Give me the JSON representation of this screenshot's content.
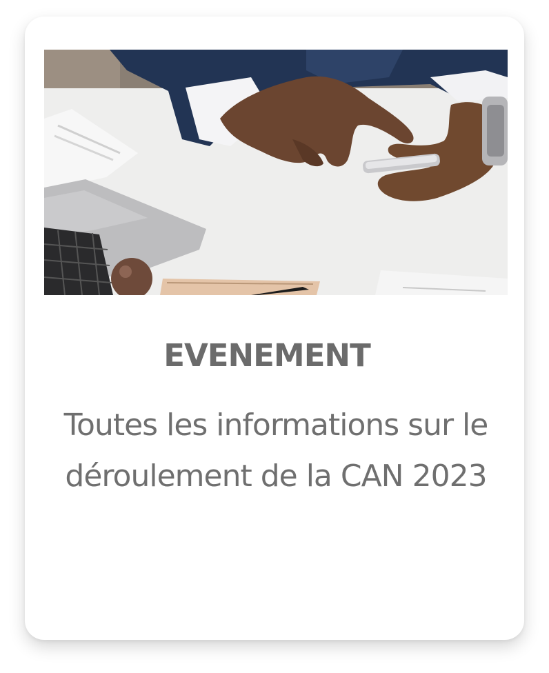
{
  "card": {
    "image_description": "hands holding smartphone on desk",
    "title": "EVENEMENT",
    "description": "Toutes les informations sur le déroulement de la CAN 2023"
  }
}
